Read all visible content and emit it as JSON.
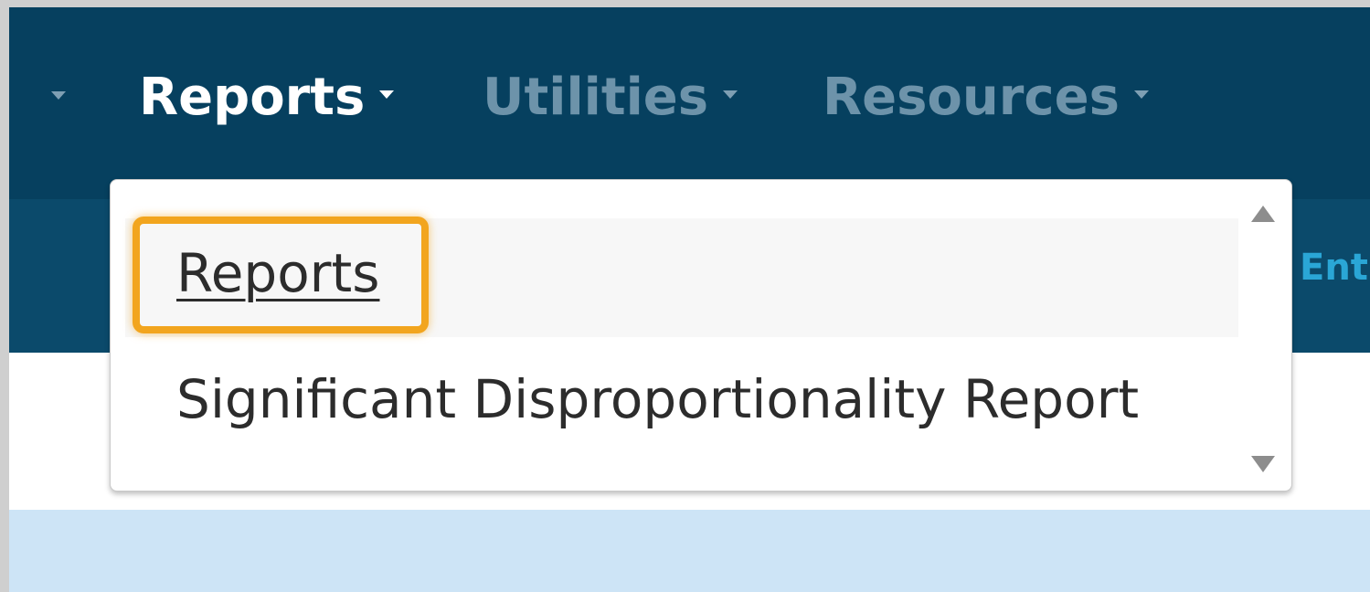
{
  "nav": {
    "items": [
      {
        "label": "Reports",
        "active": true
      },
      {
        "label": "Utilities",
        "active": false
      },
      {
        "label": "Resources",
        "active": false
      }
    ]
  },
  "subnav": {
    "partial_label": "Ent"
  },
  "dropdown": {
    "items": [
      {
        "label": "Reports",
        "highlighted": true
      },
      {
        "label": "Significant Disproportionality Report",
        "highlighted": false
      }
    ]
  },
  "icons": {
    "caret": "caret-down-icon",
    "scroll_up": "scroll-up-arrow-icon",
    "scroll_down": "scroll-down-arrow-icon"
  },
  "colors": {
    "nav_bg": "#06405f",
    "subnav_bg": "#0b4a6b",
    "highlight_border": "#f2a51e",
    "content_blue": "#cde4f6"
  }
}
